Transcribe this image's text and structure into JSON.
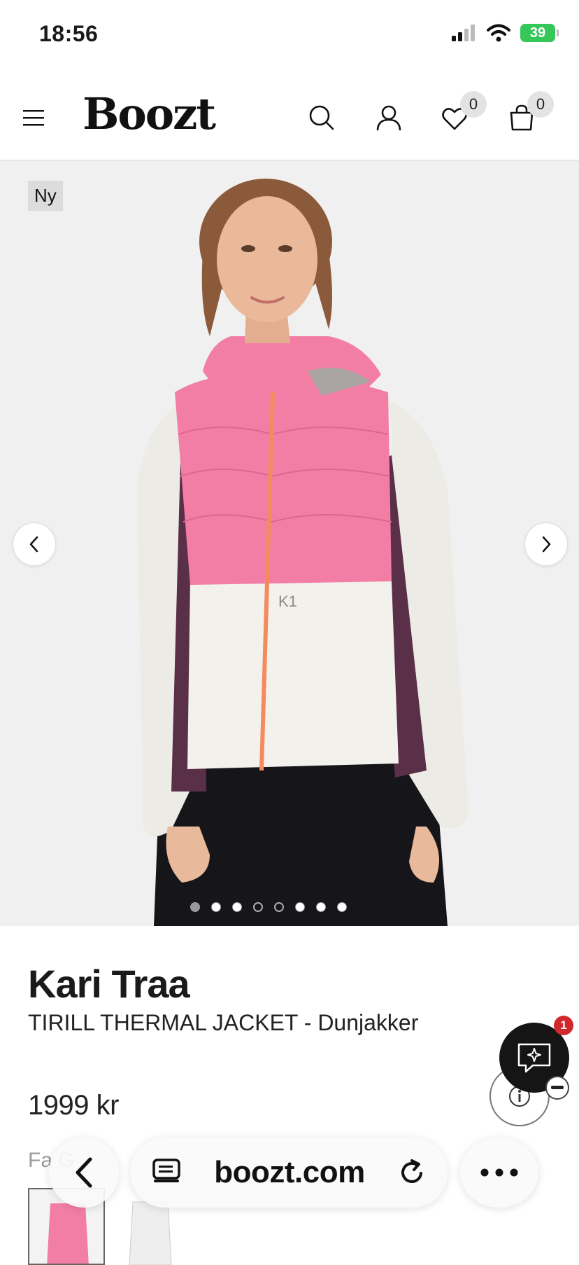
{
  "status_bar": {
    "time": "18:56",
    "battery": "39"
  },
  "header": {
    "logo": "Boozt",
    "wishlist_count": "0",
    "cart_count": "0"
  },
  "gallery": {
    "badge": "Ny",
    "dot_count": 8,
    "active_index": 0
  },
  "product": {
    "brand": "Kari Traa",
    "name": "TIRILL THERMAL JACKET - Dunjakker",
    "price": "1999 kr",
    "color_label": "Fa    G"
  },
  "chat": {
    "badge_count": "1"
  },
  "browser": {
    "url": "boozt.com"
  },
  "colors": {
    "pink": "#f27ea6",
    "plum": "#5a2f48",
    "cream": "#f3f1ec",
    "orange_zip": "#f58a5e",
    "battery": "#35c759"
  }
}
